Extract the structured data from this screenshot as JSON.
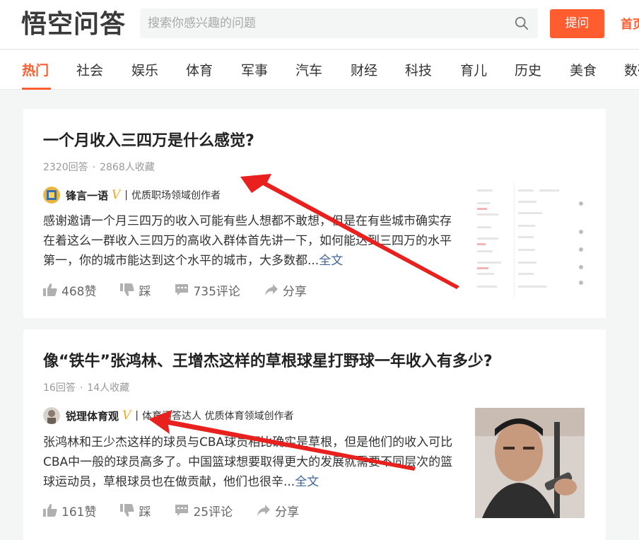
{
  "header": {
    "logo_text": "悟空问答",
    "search_placeholder": "搜索你感兴趣的问题",
    "ask_label": "提问",
    "home_label": "首页"
  },
  "nav": {
    "tabs": [
      "热门",
      "社会",
      "娱乐",
      "体育",
      "军事",
      "汽车",
      "财经",
      "科技",
      "育儿",
      "历史",
      "美食",
      "数码"
    ],
    "active": "热门"
  },
  "questions": [
    {
      "title": "一个月收入三四万是什么感觉?",
      "answers": "2320回答",
      "favorites": "2868人收藏",
      "author": "锋言一语",
      "author_desc": "优质职场领域创作者",
      "excerpt": "感谢邀请一个月三四万的收入可能有些人想都不敢想，但是在有些城市确实存在着这么一群收入三四万的高收入群体首先讲一下，如何能达到三四万的水平第一，你的城市能达到这个水平的城市，大多数都...",
      "full_label": "全文",
      "likes": "468赞",
      "dislike": "踩",
      "comments": "735评论",
      "share": "分享"
    },
    {
      "title": "像“铁牛”张鸿林、王增杰这样的草根球星打野球一年收入有多少?",
      "answers": "16回答",
      "favorites": "14人收藏",
      "author": "锐理体育观",
      "author_desc": "体育问答达人 优质体育领域创作者",
      "excerpt": "张鸿林和王少杰这样的球员与CBA球员相比确实是草根，但是他们的收入可比CBA中一般的球员高多了。中国篮球想要取得更大的发展就需要不同层次的篮球运动员，草根球员也在做贡献，他们也很辛...",
      "full_label": "全文",
      "likes": "161赞",
      "dislike": "踩",
      "comments": "25评论",
      "share": "分享"
    }
  ],
  "colors": {
    "accent": "#ff5d2f",
    "link": "#406599",
    "annotation_arrow": "#e8201e"
  }
}
